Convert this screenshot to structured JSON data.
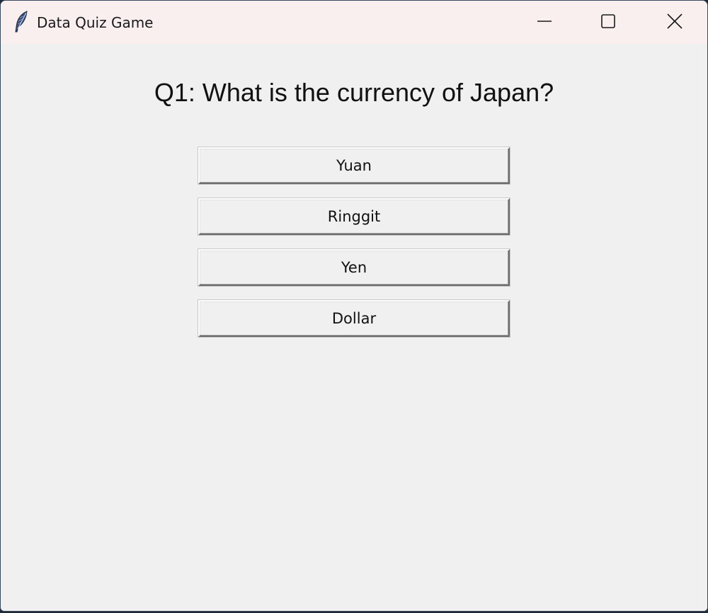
{
  "window": {
    "title": "Data Quiz Game",
    "icon": "feather-icon",
    "controls": [
      "minimize-icon",
      "maximize-icon",
      "close-icon"
    ]
  },
  "quiz": {
    "question": "Q1: What is the currency of Japan?",
    "answers": [
      "Yuan",
      "Ringgit",
      "Yen",
      "Dollar"
    ]
  }
}
